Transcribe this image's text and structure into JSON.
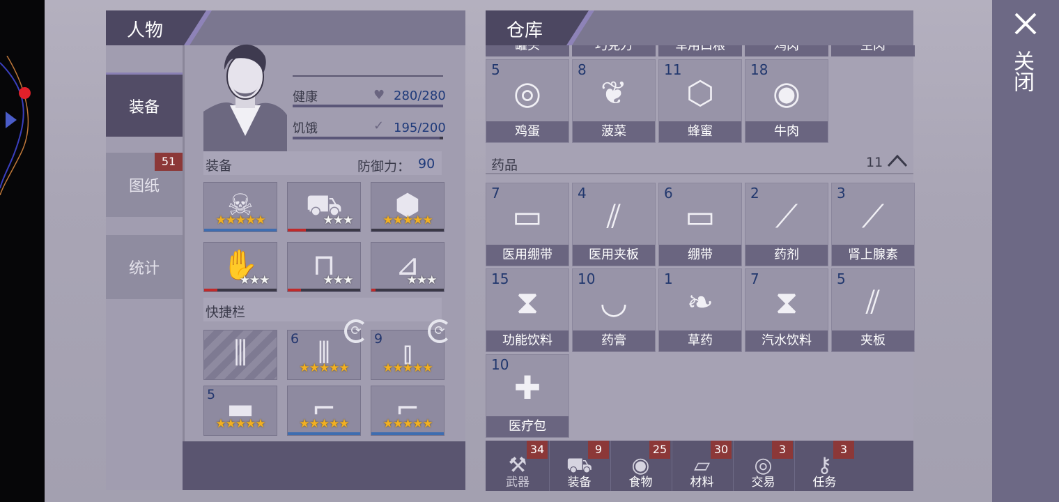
{
  "character": {
    "title": "人物",
    "tabs": [
      {
        "label": "装备",
        "active": true
      },
      {
        "label": "图纸",
        "badge": "51"
      },
      {
        "label": "统计"
      }
    ],
    "health_label": "健康",
    "health_value": "280/280",
    "health_fraction": 1.0,
    "hunger_label": "饥饿",
    "hunger_value": "195/200",
    "hunger_fraction": 0.975,
    "equip_label": "装备",
    "defense_label": "防御力：",
    "defense_value": "90",
    "quickbar_label": "快捷栏",
    "equipment": [
      {
        "icon": "plague-mask-icon",
        "stars": 5,
        "gold": true,
        "durability": 1.0,
        "bar_color": "#3e6db0"
      },
      {
        "icon": "shirt-icon",
        "stars": 3,
        "gold": false,
        "durability": 0.25,
        "bar_color": "#c02a2a"
      },
      {
        "icon": "turtle-shell-icon",
        "stars": 5,
        "gold": true,
        "durability": 0.0,
        "bar_color": "#c02a2a"
      },
      {
        "icon": "gloves-icon",
        "stars": 3,
        "gold": false,
        "durability": 0.18,
        "bar_color": "#c02a2a"
      },
      {
        "icon": "pants-icon",
        "stars": 3,
        "gold": false,
        "durability": 0.18,
        "bar_color": "#c02a2a"
      },
      {
        "icon": "boots-icon",
        "stars": 3,
        "gold": false,
        "durability": 0.06,
        "bar_color": "#c02a2a"
      }
    ],
    "quickbar": [
      {
        "icon": "empty-ammo-slot-icon",
        "count": "",
        "stars": 0
      },
      {
        "icon": "shotgun-shells-icon",
        "count": "6",
        "stars": 5
      },
      {
        "icon": "rifle-ammo-icon",
        "count": "9",
        "stars": 5
      },
      {
        "icon": "brick-icon",
        "count": "5",
        "stars": 5
      },
      {
        "icon": "shotgun-icon",
        "count": "",
        "stars": 5
      },
      {
        "icon": "rifle-icon",
        "count": "",
        "stars": 5
      }
    ]
  },
  "warehouse": {
    "title": "仓库",
    "top_partial": [
      "罐头",
      "巧克力",
      "军用口粮",
      "鸡肉",
      "生肉"
    ],
    "food_items": [
      {
        "count": "5",
        "name": "鸡蛋",
        "icon": "eggs-icon"
      },
      {
        "count": "8",
        "name": "菠菜",
        "icon": "spinach-icon"
      },
      {
        "count": "11",
        "name": "蜂蜜",
        "icon": "honeycomb-icon"
      },
      {
        "count": "18",
        "name": "牛肉",
        "icon": "beef-icon"
      }
    ],
    "medicine_section": {
      "label": "药品",
      "count": "11"
    },
    "medicine_items": [
      {
        "count": "7",
        "name": "医用绷带",
        "icon": "medical-bandage-icon"
      },
      {
        "count": "4",
        "name": "医用夹板",
        "icon": "medical-splint-icon"
      },
      {
        "count": "6",
        "name": "绷带",
        "icon": "bandage-icon"
      },
      {
        "count": "2",
        "name": "药剂",
        "icon": "vial-icon"
      },
      {
        "count": "3",
        "name": "肾上腺素",
        "icon": "syringe-icon"
      },
      {
        "count": "15",
        "name": "功能饮料",
        "icon": "energy-drink-icon"
      },
      {
        "count": "10",
        "name": "药膏",
        "icon": "mortar-icon"
      },
      {
        "count": "1",
        "name": "草药",
        "icon": "herb-icon"
      },
      {
        "count": "7",
        "name": "汽水饮料",
        "icon": "soda-bottle-icon"
      },
      {
        "count": "5",
        "name": "夹板",
        "icon": "splint-icon"
      },
      {
        "count": "10",
        "name": "医疗包",
        "icon": "first-aid-kit-icon"
      }
    ],
    "bottom_tabs": [
      {
        "label": "武器",
        "badge": "34",
        "icon": "axe-icon"
      },
      {
        "label": "装备",
        "badge": "9",
        "icon": "tshirt-icon"
      },
      {
        "label": "食物",
        "badge": "25",
        "icon": "meat-icon"
      },
      {
        "label": "材料",
        "badge": "30",
        "icon": "wood-icon"
      },
      {
        "label": "交易",
        "badge": "3",
        "icon": "coin-icon"
      },
      {
        "label": "任务",
        "badge": "3",
        "icon": "key-icon"
      }
    ]
  },
  "close_label": "关闭"
}
